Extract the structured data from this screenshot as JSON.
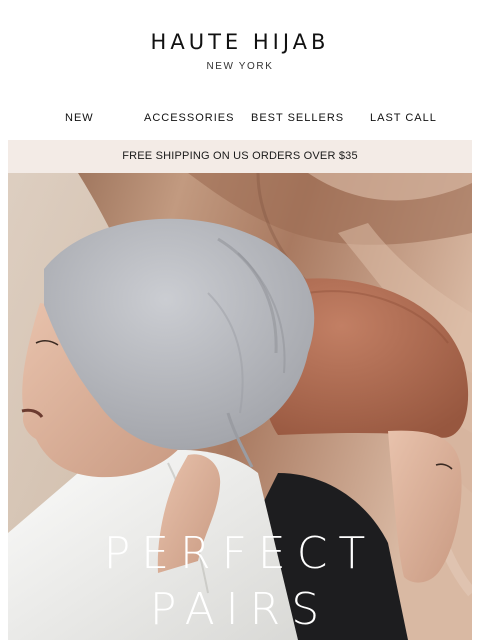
{
  "header": {
    "brand_name": "HAUTE HIJAB",
    "brand_city": "NEW YORK"
  },
  "nav": {
    "items": [
      {
        "label": "NEW"
      },
      {
        "label": "ACCESSORIES"
      },
      {
        "label": "BEST SELLERS"
      },
      {
        "label": "LAST CALL"
      }
    ]
  },
  "promo": {
    "text": "FREE SHIPPING ON US ORDERS OVER $35"
  },
  "hero": {
    "title_line1": "PERFECT",
    "title_line2": "PAIRS",
    "colors": {
      "backdrop_silk": "#b98c72",
      "grey_cap": "#b4b6bb",
      "terracotta_cap": "#b06e55",
      "skin": "#ddb29c",
      "white_top": "#eeeeec",
      "black_top": "#1d1d1f"
    }
  }
}
